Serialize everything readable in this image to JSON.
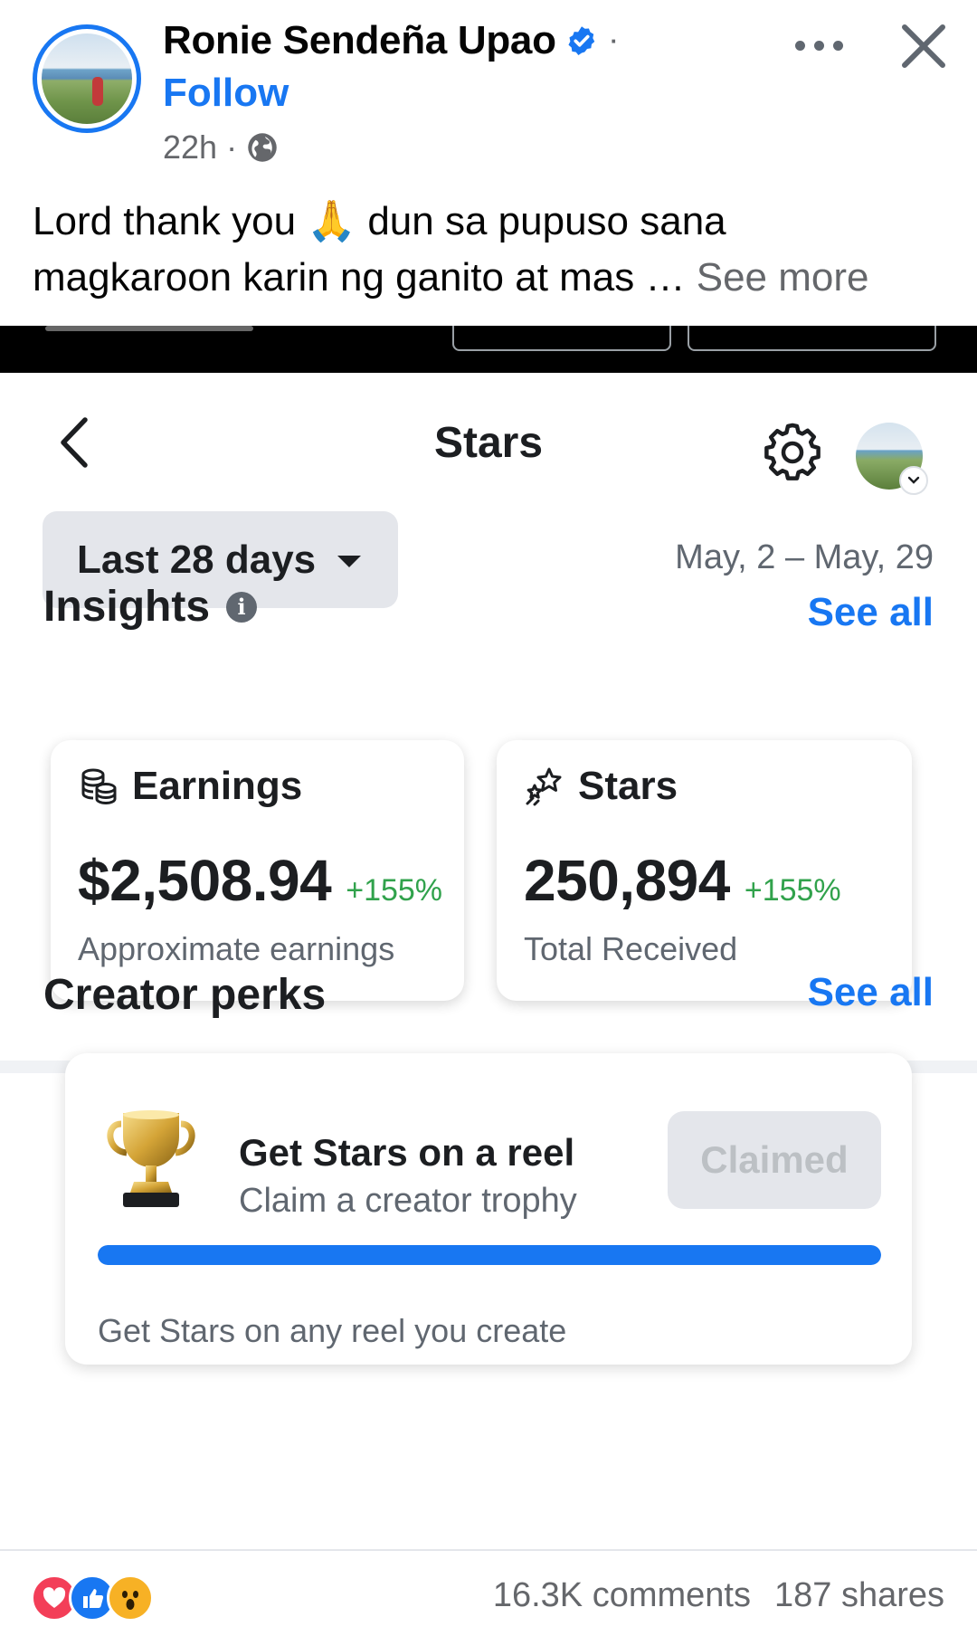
{
  "post": {
    "author": "Ronie Sendeña Upao",
    "follow_label": "Follow",
    "time": "22h",
    "separator": "·",
    "text_line1": "Lord thank you 🙏 dun sa pupuso sana",
    "text_line2": "magkaroon karin ng ganito at mas …",
    "see_more": "See more"
  },
  "screen": {
    "title": "Stars",
    "range_label": "Last 28 days",
    "date_range": "May, 2 – May, 29",
    "insights": {
      "title": "Insights",
      "see_all": "See all",
      "cards": [
        {
          "title": "Earnings",
          "value": "$2,508.94",
          "change": "+155%",
          "subtitle": "Approximate earnings",
          "icon": "coins-icon"
        },
        {
          "title": "Stars",
          "value": "250,894",
          "change": "+155%",
          "subtitle": "Total Received",
          "icon": "stars-icon"
        }
      ]
    },
    "perks": {
      "title": "Creator perks",
      "see_all": "See all",
      "card": {
        "title": "Get Stars on a reel",
        "subtitle": "Claim a creator trophy",
        "button": "Claimed",
        "progress": 1.0,
        "note": "Get Stars on any reel you create"
      }
    }
  },
  "footer": {
    "comments": "16.3K comments",
    "shares": "187 shares",
    "reactions": [
      "love",
      "like",
      "wow"
    ]
  },
  "colors": {
    "accent": "#1877f2",
    "positive": "#31a24c",
    "muted": "#606770",
    "chip_bg": "#e4e6eb"
  }
}
